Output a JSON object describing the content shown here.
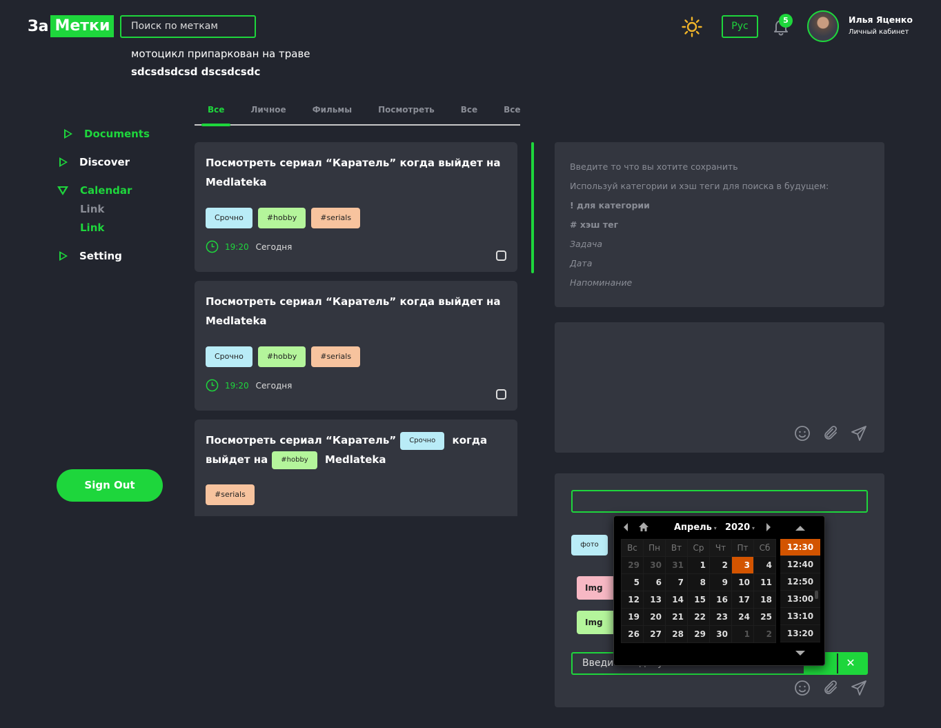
{
  "header": {
    "logo_part1": "За",
    "logo_part2": "Метки",
    "search_placeholder": "Поиск по меткам",
    "line1": "мотоцикл припаркован на траве",
    "line2": "sdcsdsdcsd dscsdcsdc",
    "lang": "Рус",
    "notifications": "5",
    "user_name": "Илья Яценко",
    "user_cabinet": "Личный кабинет"
  },
  "sidebar": {
    "documents": "Documents",
    "discover": "Discover",
    "calendar": "Calendar",
    "link1": "Link",
    "link2": "Link",
    "setting": "Setting",
    "sign_out": "Sign Out"
  },
  "tabs": [
    "Все",
    "Личное",
    "Фильмы",
    "Посмотреть",
    "Все",
    "Все"
  ],
  "cards": [
    {
      "title": "Посмотреть сериал “Каратель” когда выйдет на Medlateka",
      "tags": [
        "Срочно",
        "#hobby",
        "#serials"
      ],
      "time": "19:20",
      "day": "Сегодня"
    },
    {
      "title": "Посмотреть сериал “Каратель” когда выйдет на Medlateka",
      "tags": [
        "Срочно",
        "#hobby",
        "#serials"
      ],
      "time": "19:20",
      "day": "Сегодня"
    },
    {
      "title_part1": "Посмотреть сериал “Каратель”",
      "inline_tag1": "Срочно",
      "title_part2": "когда",
      "title_part3": "выйдет на",
      "inline_tag2": "#hobby",
      "title_part4": "Medlateka",
      "tag": "#serials"
    }
  ],
  "hints": {
    "h1": "Введите то что вы хотите сохранить",
    "h2": "Используй категории и хэш теги для поиска в будущем:",
    "h3": "! для категории",
    "h4": "# хэш тег",
    "h5": "Задача",
    "h6": "Дата",
    "h7": "Напоминание"
  },
  "compose": {
    "foto": "фото",
    "img1": "Img",
    "img2": "Img",
    "input_text": "Введите задачу",
    "close": "✕"
  },
  "datepicker": {
    "month": "Апрель",
    "year": "2020",
    "weekdays": [
      "Вс",
      "Пн",
      "Вт",
      "Ср",
      "Чт",
      "Пт",
      "Сб"
    ],
    "weeks": [
      [
        "29",
        "30",
        "31",
        "1",
        "2",
        "3",
        "4"
      ],
      [
        "5",
        "6",
        "7",
        "8",
        "9",
        "10",
        "11"
      ],
      [
        "12",
        "13",
        "14",
        "15",
        "16",
        "17",
        "18"
      ],
      [
        "19",
        "20",
        "21",
        "22",
        "23",
        "24",
        "25"
      ],
      [
        "26",
        "27",
        "28",
        "29",
        "30",
        "1",
        "2"
      ]
    ],
    "selected_day": "3",
    "times": [
      "12:30",
      "12:40",
      "12:50",
      "13:00",
      "13:10",
      "13:20"
    ],
    "selected_time": "12:30"
  },
  "colors": {
    "accent": "#1ed63c",
    "background": "#22252e",
    "card": "#33363f",
    "selected": "#d35400"
  }
}
